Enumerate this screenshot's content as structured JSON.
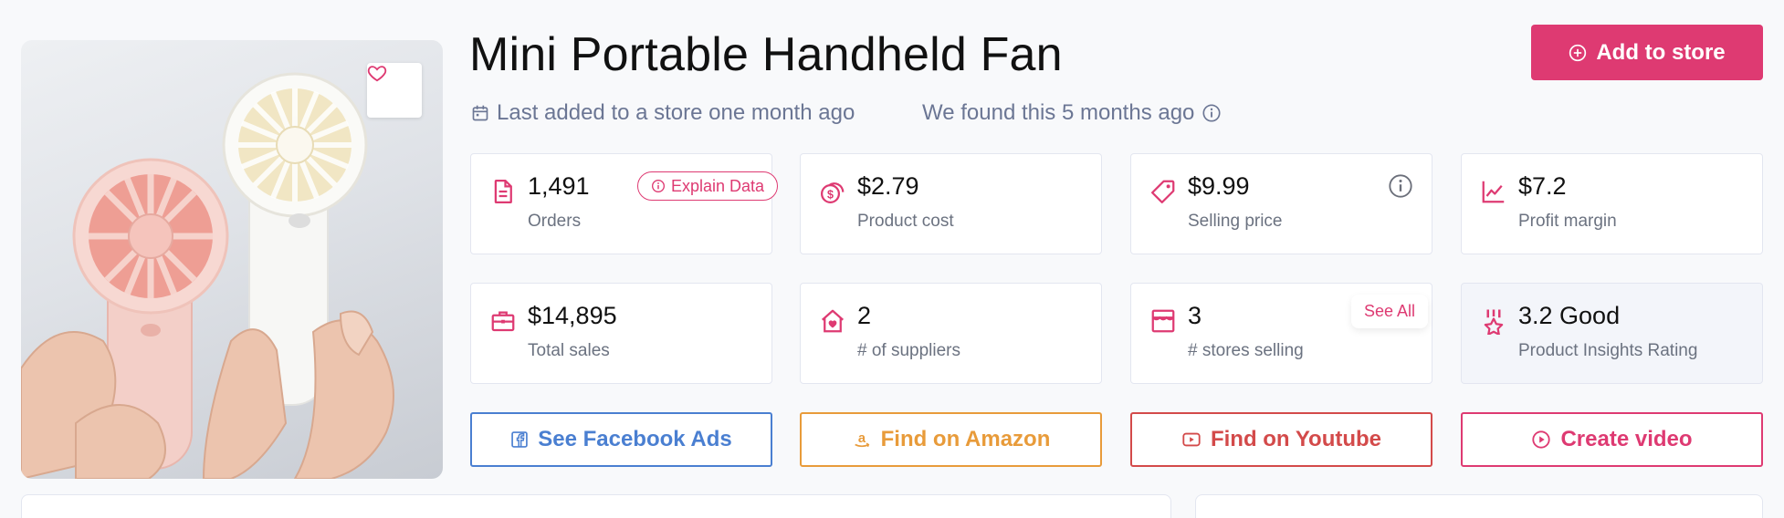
{
  "product": {
    "title": "Mini Portable Handheld Fan",
    "last_added": "Last added to a store one month ago",
    "found": "We found this 5 months ago"
  },
  "actions_top": {
    "add_to_store": "Add to store"
  },
  "stats": {
    "orders": {
      "value": "1,491",
      "label": "Orders",
      "explain": "Explain Data"
    },
    "product_cost": {
      "value": "$2.79",
      "label": "Product cost"
    },
    "selling_price": {
      "value": "$9.99",
      "label": "Selling price"
    },
    "profit_margin": {
      "value": "$7.2",
      "label": "Profit margin"
    },
    "total_sales": {
      "value": "$14,895",
      "label": "Total sales"
    },
    "suppliers": {
      "value": "2",
      "label": "# of suppliers"
    },
    "stores_selling": {
      "value": "3",
      "label": "# stores selling",
      "see_all": "See All"
    },
    "rating": {
      "value": "3.2 Good",
      "label": "Product Insights Rating"
    }
  },
  "actions": {
    "facebook": "See Facebook Ads",
    "amazon": "Find on Amazon",
    "youtube": "Find on Youtube",
    "video": "Create video"
  },
  "colors": {
    "accent": "#de3a72",
    "muted_text": "#6b7694",
    "facebook": "#4a7fd1",
    "amazon": "#e89b3a",
    "youtube": "#d34a4a"
  },
  "icons": {
    "favorite": "heart-icon",
    "add": "plus-circle-icon",
    "calendar": "calendar-icon",
    "info": "info-icon",
    "orders": "document-icon",
    "cost": "coins-icon",
    "price": "tag-icon",
    "margin": "trend-line-icon",
    "sales": "briefcase-icon",
    "suppliers": "house-heart-icon",
    "stores": "storefront-icon",
    "rating": "award-icon",
    "facebook": "facebook-icon",
    "amazon": "amazon-icon",
    "youtube": "youtube-icon",
    "video": "play-circle-icon"
  }
}
